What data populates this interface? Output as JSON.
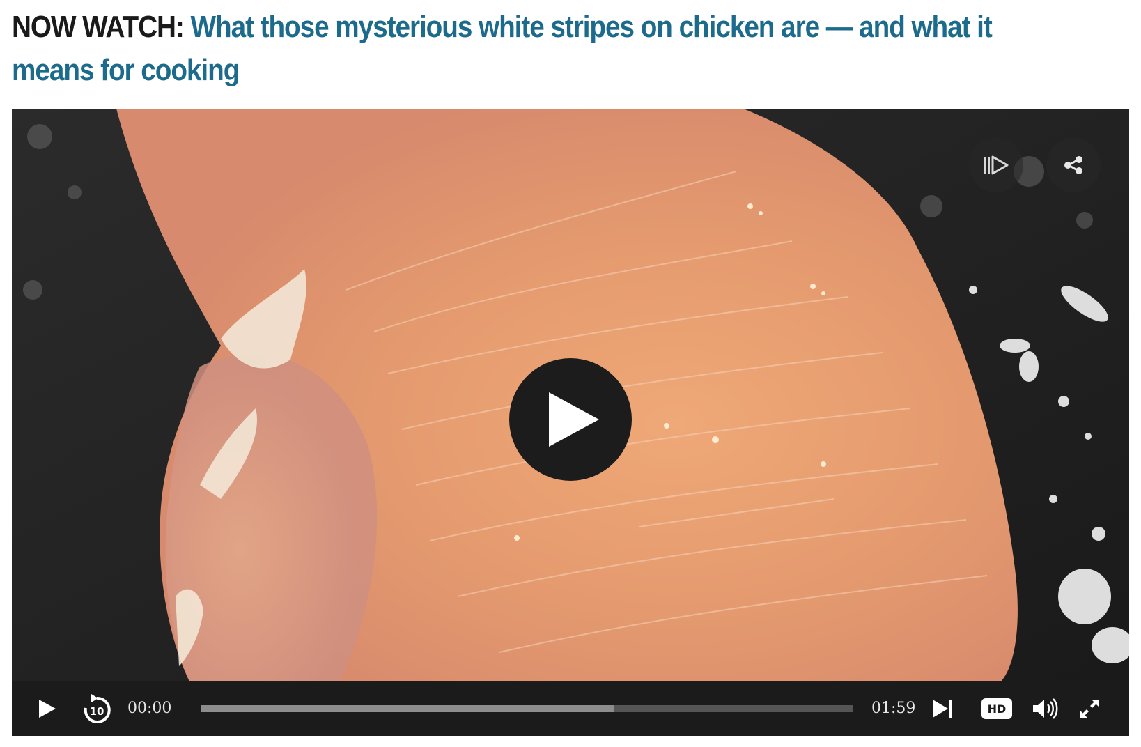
{
  "headline": {
    "kicker": "NOW WATCH: ",
    "link_text": "What those mysterious white stripes on chicken are — and what it means for cooking"
  },
  "player": {
    "top_buttons": [
      {
        "name": "up-next",
        "icon": "up-next-icon"
      },
      {
        "name": "share",
        "icon": "share-icon"
      }
    ],
    "big_play_icon": "play-icon",
    "controls": {
      "current_time": "00:00",
      "duration": "01:59",
      "hd_label": "HD",
      "rewind_seconds": "10",
      "progress_fraction": 0.634
    }
  },
  "colors": {
    "headline_kicker": "#1a1a1a",
    "headline_link": "#1c6a8c",
    "control_bar": "#1b1b1b",
    "progress_track": "#555555",
    "progress_buffered": "#8d8d8d"
  }
}
